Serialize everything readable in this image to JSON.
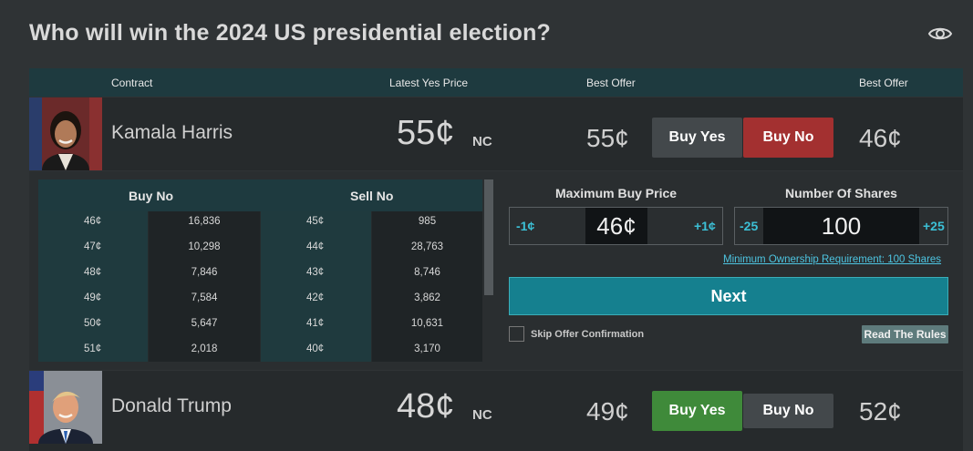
{
  "title": "Who will win the 2024 US presidential election?",
  "header": {
    "contract": "Contract",
    "latest_yes_price": "Latest Yes Price",
    "best_offer_1": "Best Offer",
    "best_offer_2": "Best Offer"
  },
  "contracts": [
    {
      "name": "Kamala Harris",
      "latest_price": "55¢",
      "change": "NC",
      "best_offer_yes": "55¢",
      "buy_yes": "Buy Yes",
      "buy_no": "Buy No",
      "best_offer_no": "46¢"
    },
    {
      "name": "Donald Trump",
      "latest_price": "48¢",
      "change": "NC",
      "best_offer_yes": "49¢",
      "buy_yes": "Buy Yes",
      "buy_no": "Buy No",
      "best_offer_no": "52¢"
    }
  ],
  "order_book": {
    "buy_no_label": "Buy No",
    "sell_no_label": "Sell No",
    "rows": [
      {
        "buy_price": "46¢",
        "buy_qty": "16,836",
        "sell_price": "45¢",
        "sell_qty": "985"
      },
      {
        "buy_price": "47¢",
        "buy_qty": "10,298",
        "sell_price": "44¢",
        "sell_qty": "28,763"
      },
      {
        "buy_price": "48¢",
        "buy_qty": "7,846",
        "sell_price": "43¢",
        "sell_qty": "8,746"
      },
      {
        "buy_price": "49¢",
        "buy_qty": "7,584",
        "sell_price": "42¢",
        "sell_qty": "3,862"
      },
      {
        "buy_price": "50¢",
        "buy_qty": "5,647",
        "sell_price": "41¢",
        "sell_qty": "10,631"
      },
      {
        "buy_price": "51¢",
        "buy_qty": "2,018",
        "sell_price": "40¢",
        "sell_qty": "3,170"
      }
    ]
  },
  "trade_form": {
    "max_price_label": "Maximum Buy Price",
    "price_minus": "-1¢",
    "price_value": "46¢",
    "price_plus": "+1¢",
    "shares_label": "Number Of Shares",
    "shares_minus": "-25",
    "shares_value": "100",
    "shares_plus": "+25",
    "min_requirement": "Minimum Ownership Requirement: 100 Shares",
    "next": "Next",
    "skip_confirmation": "Skip Offer Confirmation",
    "read_rules": "Read The Rules"
  },
  "colors": {
    "background": "#2f3335",
    "header_teal": "#1e3a3f",
    "buy_no_red": "#a33030",
    "buy_yes_green": "#3f8a3a",
    "next_teal": "#15808f",
    "link_cyan": "#4dc4e0"
  },
  "icons": {
    "visibility": "eye-icon"
  }
}
